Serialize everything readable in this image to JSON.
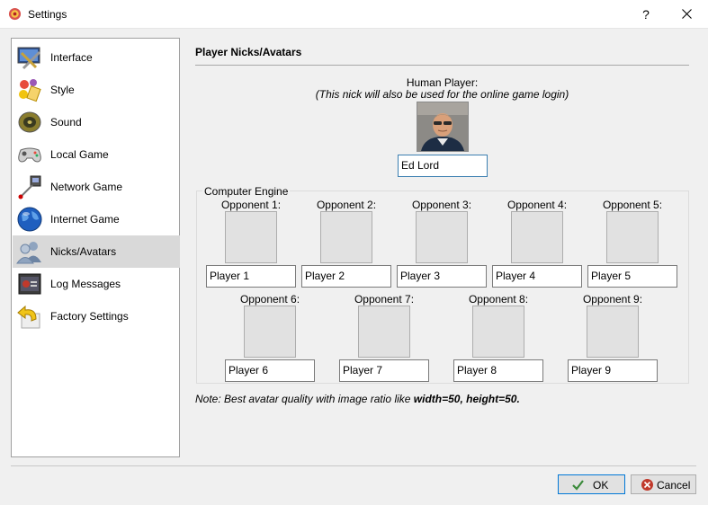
{
  "window": {
    "title": "Settings",
    "help": "?",
    "close": "✕"
  },
  "sidebar": {
    "items": [
      {
        "label": "Interface",
        "icon": "interface-icon"
      },
      {
        "label": "Style",
        "icon": "style-icon"
      },
      {
        "label": "Sound",
        "icon": "speaker-icon"
      },
      {
        "label": "Local Game",
        "icon": "gamepad-icon"
      },
      {
        "label": "Network Game",
        "icon": "network-icon"
      },
      {
        "label": "Internet Game",
        "icon": "globe-icon"
      },
      {
        "label": "Nicks/Avatars",
        "icon": "users-icon"
      },
      {
        "label": "Log Messages",
        "icon": "log-icon"
      },
      {
        "label": "Factory Settings",
        "icon": "undo-icon"
      }
    ],
    "selected": "Nicks/Avatars"
  },
  "panel": {
    "title": "Player Nicks/Avatars",
    "human_label": "Human Player:",
    "human_note": "(This nick will also be used for the online game login)",
    "human_nick": "Ed Lord",
    "engine_title": "Computer Engine",
    "opponents": [
      {
        "label": "Opponent 1:",
        "nick": "Player 1"
      },
      {
        "label": "Opponent 2:",
        "nick": "Player 2"
      },
      {
        "label": "Opponent 3:",
        "nick": "Player 3"
      },
      {
        "label": "Opponent 4:",
        "nick": "Player 4"
      },
      {
        "label": "Opponent 5:",
        "nick": "Player 5"
      },
      {
        "label": "Opponent 6:",
        "nick": "Player 6"
      },
      {
        "label": "Opponent 7:",
        "nick": "Player 7"
      },
      {
        "label": "Opponent 8:",
        "nick": "Player 8"
      },
      {
        "label": "Opponent 9:",
        "nick": "Player 9"
      }
    ],
    "note_prefix": "Note: Best avatar quality with image ratio like ",
    "note_bold": "width=50, height=50."
  },
  "buttons": {
    "ok": "OK",
    "cancel": "Cancel"
  },
  "colors": {
    "selected_bg": "#d9d9d9",
    "focus_border": "#0078d7",
    "cancel_red": "#c0392b",
    "ok_green": "#3a8a3a"
  }
}
